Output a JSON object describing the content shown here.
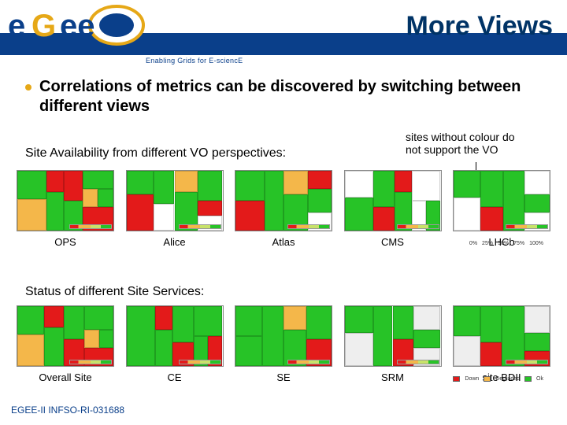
{
  "header": {
    "title": "More Views",
    "tagline": "Enabling Grids for E-sciencE",
    "logo_text_top": "e",
    "logo_text_bottom": "ee"
  },
  "bullet": "Correlations of metrics can be discovered by switching between different views",
  "section1_label": "Site Availability from different VO perspectives:",
  "section2_label": "Status of different Site Services:",
  "annotation_line1": "sites without colour do",
  "annotation_line2": "not support the VO",
  "row1_panels": [
    {
      "label": "OPS"
    },
    {
      "label": "Alice"
    },
    {
      "label": "Atlas"
    },
    {
      "label": "CMS"
    },
    {
      "label": "LHCb"
    }
  ],
  "row2_panels": [
    {
      "label": "Overall Site"
    },
    {
      "label": "CE"
    },
    {
      "label": "SE"
    },
    {
      "label": "SRM"
    },
    {
      "label": "site BDII"
    }
  ],
  "legend1": {
    "t0": "0%",
    "t1": "25%",
    "t2": "50%",
    "t3": "75%",
    "t4": "100%"
  },
  "legend2": {
    "a": "Down",
    "b": "Degraded",
    "c": "Ok"
  },
  "footer": "EGEE-II INFSO-RI-031688"
}
